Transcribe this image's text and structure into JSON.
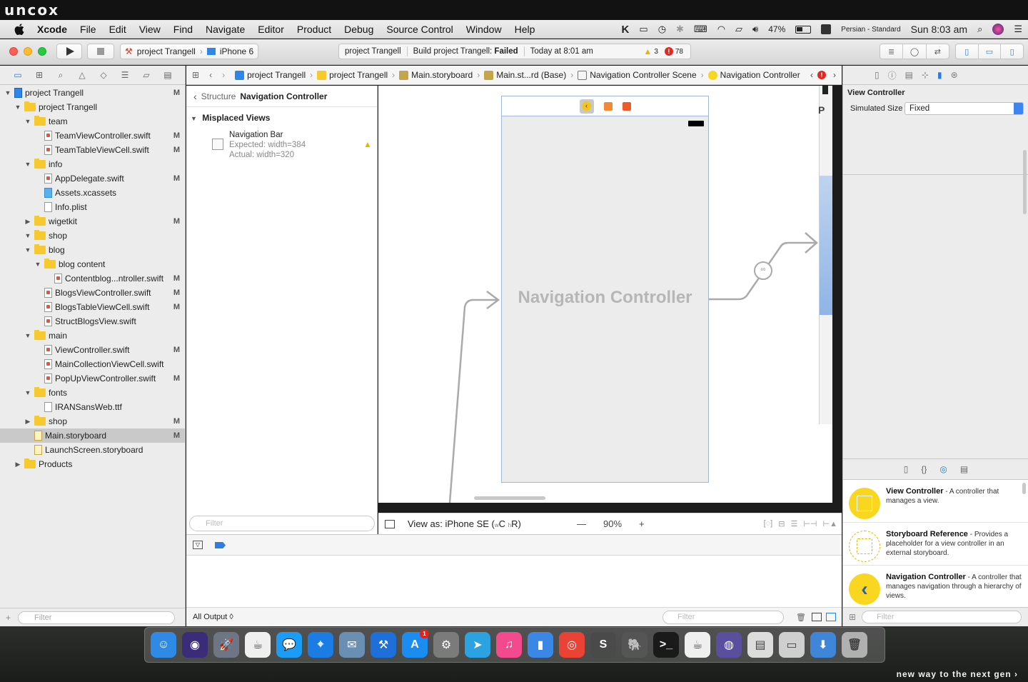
{
  "branding": {
    "logo": "uncox",
    "tagline": "new way to the next gen ›"
  },
  "menubar": {
    "app": "Xcode",
    "items": [
      "File",
      "Edit",
      "View",
      "Find",
      "Navigate",
      "Editor",
      "Product",
      "Debug",
      "Source Control",
      "Window",
      "Help"
    ],
    "battery": "47%",
    "input_source": "Persian - Standard",
    "clock": "Sun 8:03 am"
  },
  "toolbar": {
    "scheme_project": "project Trangell",
    "scheme_device": "iPhone 6",
    "activity_project": "project Trangell",
    "activity_status_prefix": "Build project Trangell: ",
    "activity_status": "Failed",
    "activity_time": "Today at 8:01 am",
    "warnings": "3",
    "errors": "78"
  },
  "navigator": {
    "rows": [
      {
        "label": "project Trangell",
        "kind": "project",
        "indent": 0,
        "disc": "▼",
        "flag": "M"
      },
      {
        "label": "project Trangell",
        "kind": "folder",
        "indent": 1,
        "disc": "▼",
        "flag": ""
      },
      {
        "label": "team",
        "kind": "folder",
        "indent": 2,
        "disc": "▼",
        "flag": ""
      },
      {
        "label": "TeamViewController.swift",
        "kind": "swift",
        "indent": 3,
        "disc": "",
        "flag": "M"
      },
      {
        "label": "TeamTableViewCell.swift",
        "kind": "swift",
        "indent": 3,
        "disc": "",
        "flag": "M"
      },
      {
        "label": "info",
        "kind": "folder",
        "indent": 2,
        "disc": "▼",
        "flag": ""
      },
      {
        "label": "AppDelegate.swift",
        "kind": "swift",
        "indent": 3,
        "disc": "",
        "flag": "M"
      },
      {
        "label": "Assets.xcassets",
        "kind": "assets",
        "indent": 3,
        "disc": "",
        "flag": ""
      },
      {
        "label": "Info.plist",
        "kind": "plain",
        "indent": 3,
        "disc": "",
        "flag": ""
      },
      {
        "label": "wigetkit",
        "kind": "folder",
        "indent": 2,
        "disc": "▶",
        "flag": "M"
      },
      {
        "label": "shop",
        "kind": "folder",
        "indent": 2,
        "disc": "▼",
        "flag": ""
      },
      {
        "label": "blog",
        "kind": "folder",
        "indent": 2,
        "disc": "▼",
        "flag": ""
      },
      {
        "label": "blog content",
        "kind": "folder",
        "indent": 3,
        "disc": "▼",
        "flag": ""
      },
      {
        "label": "Contentblog...ntroller.swift",
        "kind": "swift",
        "indent": 4,
        "disc": "",
        "flag": "M"
      },
      {
        "label": "BlogsViewController.swift",
        "kind": "swift",
        "indent": 3,
        "disc": "",
        "flag": "M"
      },
      {
        "label": "BlogsTableViewCell.swift",
        "kind": "swift",
        "indent": 3,
        "disc": "",
        "flag": "M"
      },
      {
        "label": "StructBlogsView.swift",
        "kind": "swift",
        "indent": 3,
        "disc": "",
        "flag": ""
      },
      {
        "label": "main",
        "kind": "folder",
        "indent": 2,
        "disc": "▼",
        "flag": ""
      },
      {
        "label": "ViewController.swift",
        "kind": "swift",
        "indent": 3,
        "disc": "",
        "flag": "M"
      },
      {
        "label": "MainCollectionViewCell.swift",
        "kind": "swift",
        "indent": 3,
        "disc": "",
        "flag": ""
      },
      {
        "label": "PopUpViewController.swift",
        "kind": "swift",
        "indent": 3,
        "disc": "",
        "flag": "M"
      },
      {
        "label": "fonts",
        "kind": "folder",
        "indent": 2,
        "disc": "▼",
        "flag": ""
      },
      {
        "label": "IRANSansWeb.ttf",
        "kind": "plain",
        "indent": 3,
        "disc": "",
        "flag": ""
      },
      {
        "label": "shop",
        "kind": "folder",
        "indent": 2,
        "disc": "▶",
        "flag": "M"
      },
      {
        "label": "Main.storyboard",
        "kind": "sb",
        "indent": 2,
        "disc": "",
        "flag": "M",
        "selected": true
      },
      {
        "label": "LaunchScreen.storyboard",
        "kind": "sb",
        "indent": 2,
        "disc": "",
        "flag": ""
      },
      {
        "label": "Products",
        "kind": "folder",
        "indent": 1,
        "disc": "▶",
        "flag": ""
      }
    ],
    "filter_placeholder": "Filter"
  },
  "jumpbar": {
    "crumbs": [
      "project Trangell",
      "project Trangell",
      "Main.storyboard",
      "Main.st...rd (Base)",
      "Navigation Controller Scene",
      "Navigation Controller"
    ]
  },
  "outline": {
    "back_label": "Structure",
    "title": "Navigation Controller",
    "section": "Misplaced Views",
    "issue_title": "Navigation Bar",
    "issue_expected": "Expected: width=384",
    "issue_actual": "Actual: width=320",
    "filter_placeholder": "Filter"
  },
  "canvas": {
    "scene_title": "Navigation Controller",
    "view_as": "View as: iPhone SE (",
    "size_class_w": "w",
    "size_class_c": "C",
    "size_class_h": "h",
    "size_class_r": "R)",
    "zoom": "90%"
  },
  "debug": {
    "output_selector": "All Output ◊",
    "filter_placeholder": "Filter"
  },
  "inspector": {
    "section": "View Controller",
    "sim_label": "Simulated Size",
    "sim_value": "Fixed",
    "library": [
      {
        "name": "View Controller",
        "desc": " - A controller that manages a view."
      },
      {
        "name": "Storyboard Reference",
        "desc": " - Provides a placeholder for a view controller in an external storyboard."
      },
      {
        "name": "Navigation Controller",
        "desc": " - A controller that manages navigation through a hierarchy of views."
      }
    ],
    "filter_placeholder": "Filter"
  },
  "dock": {
    "apps": [
      {
        "name": "finder",
        "color": "#2f8ae5",
        "glyph": "☺"
      },
      {
        "name": "siri",
        "color": "#3a2c79",
        "glyph": "◉"
      },
      {
        "name": "launchpad",
        "color": "#6e7584",
        "glyph": "🚀"
      },
      {
        "name": "java",
        "color": "#efefef",
        "glyph": "☕"
      },
      {
        "name": "messages",
        "color": "#1c9cf4",
        "glyph": "💬"
      },
      {
        "name": "safari",
        "color": "#1b7ce3",
        "glyph": "⌖"
      },
      {
        "name": "preview",
        "color": "#6b8fb3",
        "glyph": "✉"
      },
      {
        "name": "xcode",
        "color": "#1e6fd9",
        "glyph": "⚒"
      },
      {
        "name": "app-store",
        "color": "#1b8df0",
        "glyph": "A",
        "badge": "1"
      },
      {
        "name": "system-preferences",
        "color": "#7b7b7b",
        "glyph": "⚙"
      },
      {
        "name": "telegram",
        "color": "#2aa3e0",
        "glyph": "➤"
      },
      {
        "name": "itunes",
        "color": "#f24a8c",
        "glyph": "♫"
      },
      {
        "name": "keynote",
        "color": "#3a87e6",
        "glyph": "▮"
      },
      {
        "name": "chrome",
        "color": "#ea4335",
        "glyph": "◎"
      },
      {
        "name": "sublime",
        "color": "#4a4a4a",
        "glyph": "S"
      },
      {
        "name": "sequel-pro",
        "color": "#555555",
        "glyph": "🐘"
      },
      {
        "name": "terminal",
        "color": "#1a1a1a",
        "glyph": ">_"
      },
      {
        "name": "java-2",
        "color": "#efefef",
        "glyph": "☕"
      },
      {
        "name": "network-utility",
        "color": "#5a4f9e",
        "glyph": "◍"
      },
      {
        "name": "archive",
        "color": "#dcdcdc",
        "glyph": "▤"
      },
      {
        "name": "document",
        "color": "#cfcfcf",
        "glyph": "▭"
      },
      {
        "name": "downloads",
        "color": "#3f86d9",
        "glyph": "⬇"
      },
      {
        "name": "trash",
        "color": "#b0b0b0",
        "glyph": "🗑"
      }
    ]
  }
}
